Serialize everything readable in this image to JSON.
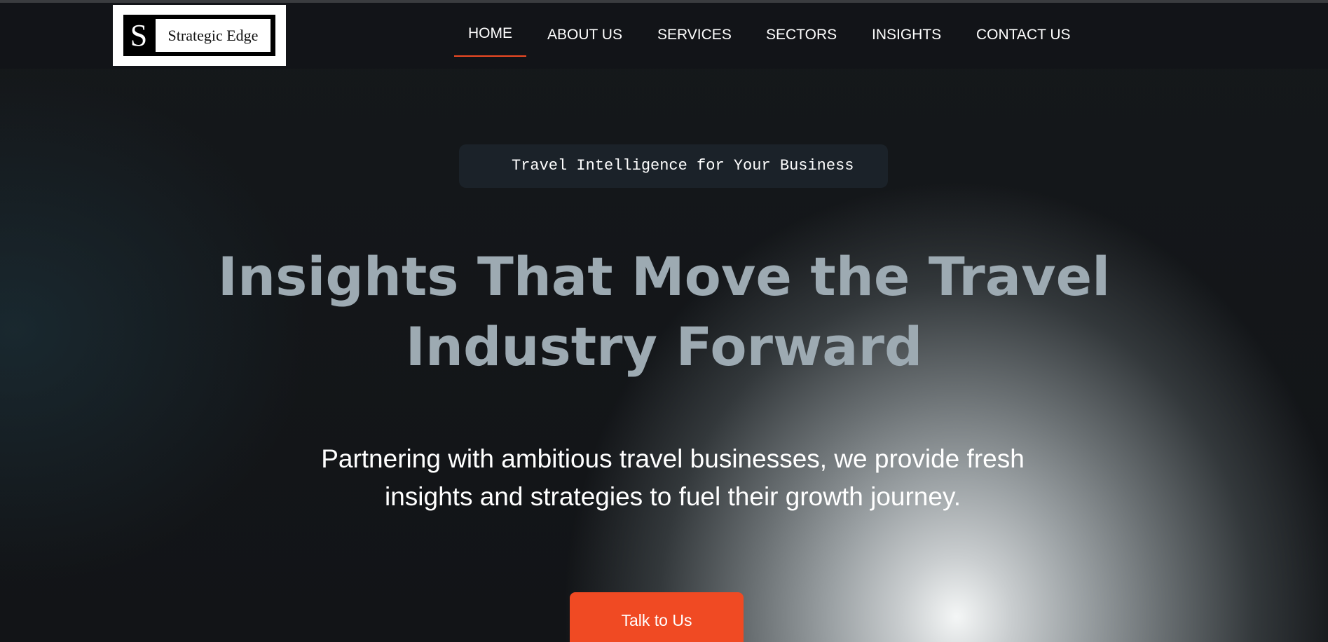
{
  "header": {
    "logo": {
      "letter": "S",
      "name": "Strategic Edge"
    },
    "nav": {
      "items": [
        {
          "label": "HOME",
          "active": true
        },
        {
          "label": "ABOUT US",
          "active": false
        },
        {
          "label": "SERVICES",
          "active": false
        },
        {
          "label": "SECTORS",
          "active": false
        },
        {
          "label": "INSIGHTS",
          "active": false
        },
        {
          "label": "CONTACT US",
          "active": false
        }
      ]
    }
  },
  "hero": {
    "tagline": "Travel Intelligence for Your Business",
    "title_line1": "Insights That Move the Travel",
    "title_line2": "Industry Forward",
    "subtitle_line1": "Partnering with ambitious travel businesses, we provide fresh",
    "subtitle_line2": "insights and strategies to fuel their growth journey.",
    "cta_label": "Talk to Us"
  },
  "colors": {
    "accent": "#f04a23",
    "background": "#111316",
    "title": "#9daab2",
    "pill": "#1b2229"
  }
}
